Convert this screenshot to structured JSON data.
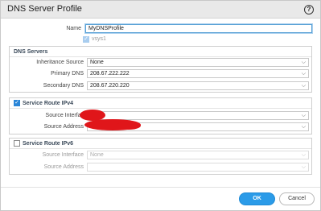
{
  "dialog": {
    "title": "DNS Server Profile",
    "help_icon": "?"
  },
  "profile": {
    "name_label": "Name",
    "name_value": "MyDNSProfile",
    "vsys_label": "vsys1",
    "vsys_checked": true
  },
  "dns_servers": {
    "title": "DNS Servers",
    "inheritance_label": "Inheritance Source",
    "inheritance_value": "None",
    "primary_label": "Primary DNS",
    "primary_value": "208.67.222.222",
    "secondary_label": "Secondary DNS",
    "secondary_value": "208.67.220.220"
  },
  "route_ipv4": {
    "title": "Service Route IPv4",
    "checked": true,
    "interface_label": "Source Interfac",
    "address_label": "Source Address",
    "redaction_color": "#e0161a"
  },
  "route_ipv6": {
    "title": "Service Route IPv6",
    "checked": false,
    "interface_label": "Source Interface",
    "interface_value": "None",
    "address_label": "Source Address"
  },
  "buttons": {
    "ok": "OK",
    "cancel": "Cancel"
  },
  "colors": {
    "accent": "#2b9be8",
    "checkbox": "#2b86d8"
  },
  "icons": {
    "dropdown": "chevron-down-icon",
    "check": "checkmark-icon",
    "help": "help-circle-icon"
  }
}
